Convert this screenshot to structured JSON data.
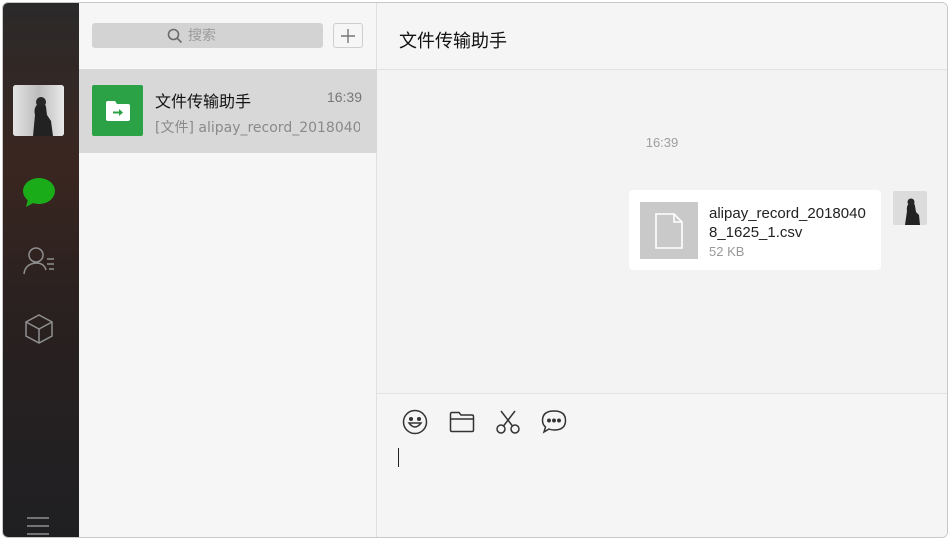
{
  "search": {
    "placeholder": "搜索"
  },
  "chat_list": [
    {
      "name": "文件传输助手",
      "time": "16:39",
      "preview": "[文件] alipay_record_2018040...",
      "icon": "folder-transfer-icon",
      "accent": "#2ba245"
    }
  ],
  "conversation": {
    "title": "文件传输助手",
    "timestamp": "16:39",
    "message": {
      "type": "file",
      "file_name": "alipay_record_20180408_1625_1.csv",
      "file_size": "52 KB",
      "icon": "document-icon"
    }
  },
  "composer": {
    "tools": [
      "emoji-icon",
      "folder-icon",
      "scissors-icon",
      "chat-bubble-icon"
    ],
    "value": ""
  },
  "rail": {
    "items": [
      "chat-icon",
      "contacts-icon",
      "favorites-box-icon",
      "menu-icon"
    ],
    "active_color": "#1aad19"
  }
}
